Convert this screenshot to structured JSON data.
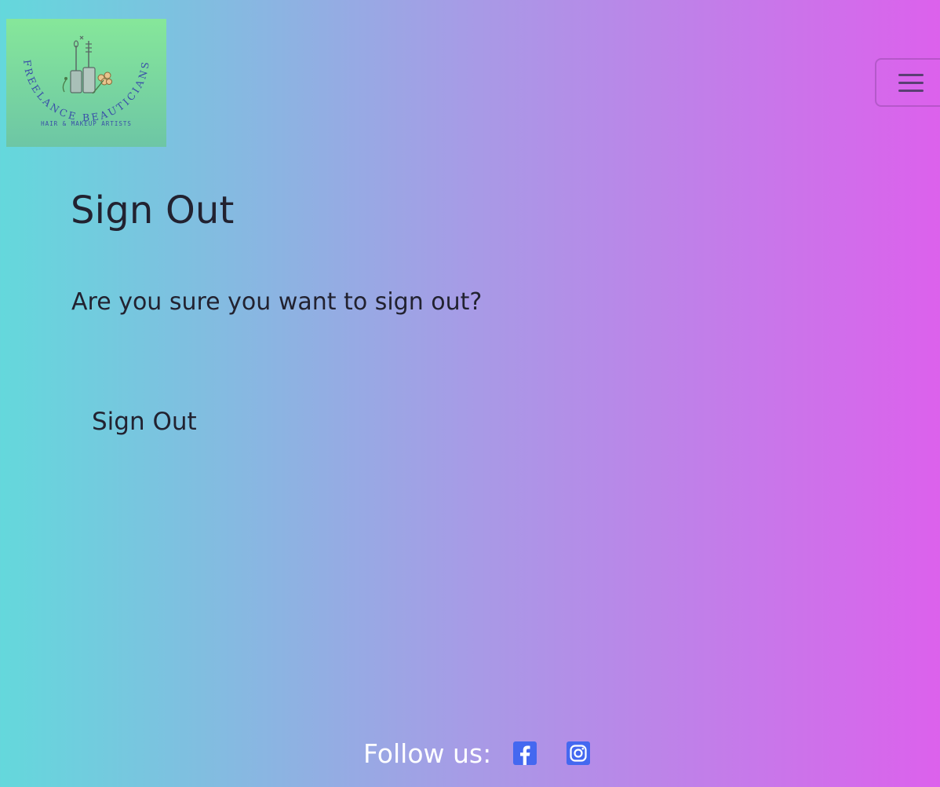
{
  "logo": {
    "brand_name": "FREELANCE BEAUTICIANS",
    "tagline": "HAIR & MAKEUP ARTISTS"
  },
  "nav": {
    "toggler_icon": "hamburger-menu-icon"
  },
  "main": {
    "title": "Sign Out",
    "prompt": "Are you sure you want to sign out?",
    "signout_button_label": "Sign Out"
  },
  "footer": {
    "follow_label": "Follow us:",
    "social": [
      {
        "icon": "facebook-icon"
      },
      {
        "icon": "instagram-icon"
      }
    ]
  },
  "colors": {
    "gradient_left": "#64d8dc",
    "gradient_middle": "#a79be6",
    "gradient_right": "#dc61ec",
    "social_icon_blue": "#4468f0",
    "text_dark": "#222230",
    "footer_text": "#ffffff"
  }
}
